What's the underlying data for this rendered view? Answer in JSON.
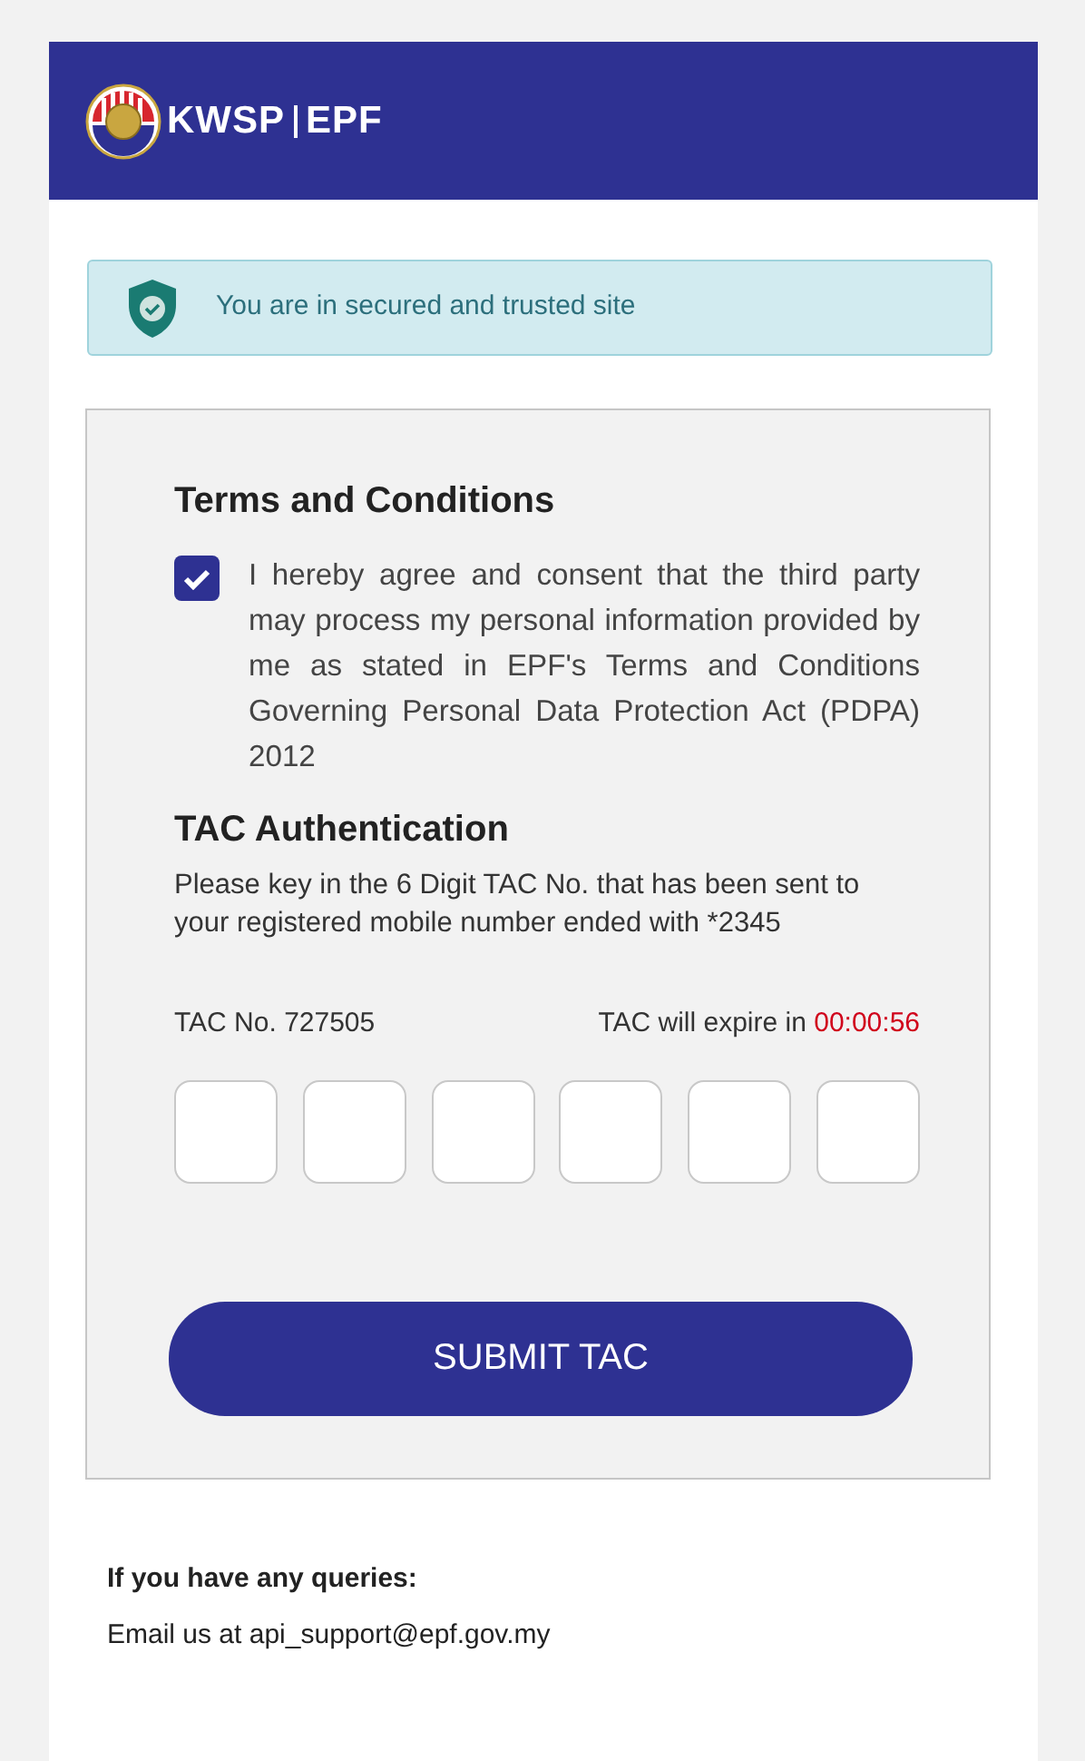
{
  "header": {
    "logo_text": "KWSP",
    "logo_text_2": "EPF"
  },
  "security_notice": "You are in secured and trusted site",
  "terms": {
    "title": "Terms and Conditions",
    "checked": true,
    "text": "I hereby agree and consent that the third party may process my personal information provided by me as stated in EPF's Terms and Conditions Governing Personal Data Protection Act (PDPA) 2012"
  },
  "tac": {
    "title": "TAC Authentication",
    "instructions": "Please key in the 6 Digit TAC No. that has been sent to your registered mobile number ended with *2345",
    "tac_number": "TAC No. 727505",
    "expiry_label": "TAC will expire in",
    "timer": "00:00:56"
  },
  "submit_button": "SUBMIT TAC",
  "footer": {
    "heading": "If you have any queries:",
    "email_text": "Email us at api_support@epf.gov.my"
  }
}
